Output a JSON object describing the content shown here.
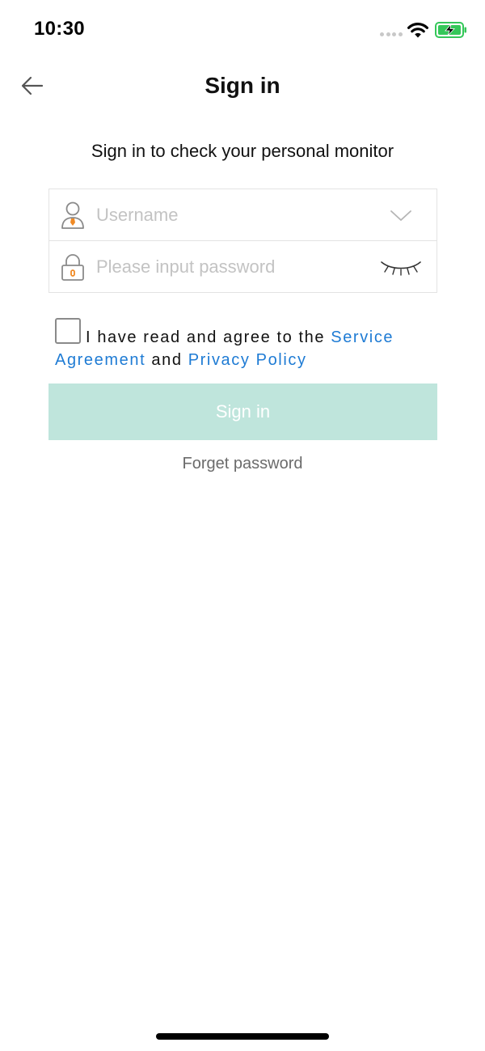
{
  "status_bar": {
    "time": "10:30"
  },
  "nav": {
    "title": "Sign in",
    "back_icon": "arrow-left-icon"
  },
  "subtitle": "Sign in to check your personal monitor",
  "form": {
    "username": {
      "value": "",
      "placeholder": "Username",
      "icon": "user-icon",
      "action_icon": "chevron-down-icon"
    },
    "password": {
      "value": "",
      "placeholder": "Please input password",
      "icon": "lock-icon",
      "action_icon": "eye-closed-icon"
    }
  },
  "agreement": {
    "checked": false,
    "prefix": "I have read and agree to the ",
    "service_link": "Service Agreement",
    "middle": " and ",
    "privacy_link": "Privacy Policy"
  },
  "signin_button": {
    "label": "Sign in"
  },
  "forget_password": {
    "label": "Forget password"
  },
  "colors": {
    "accent_link": "#1e7bd4",
    "button_disabled_bg": "#bfe5dc",
    "icon_orange": "#f08a24",
    "battery_green": "#34c759"
  }
}
